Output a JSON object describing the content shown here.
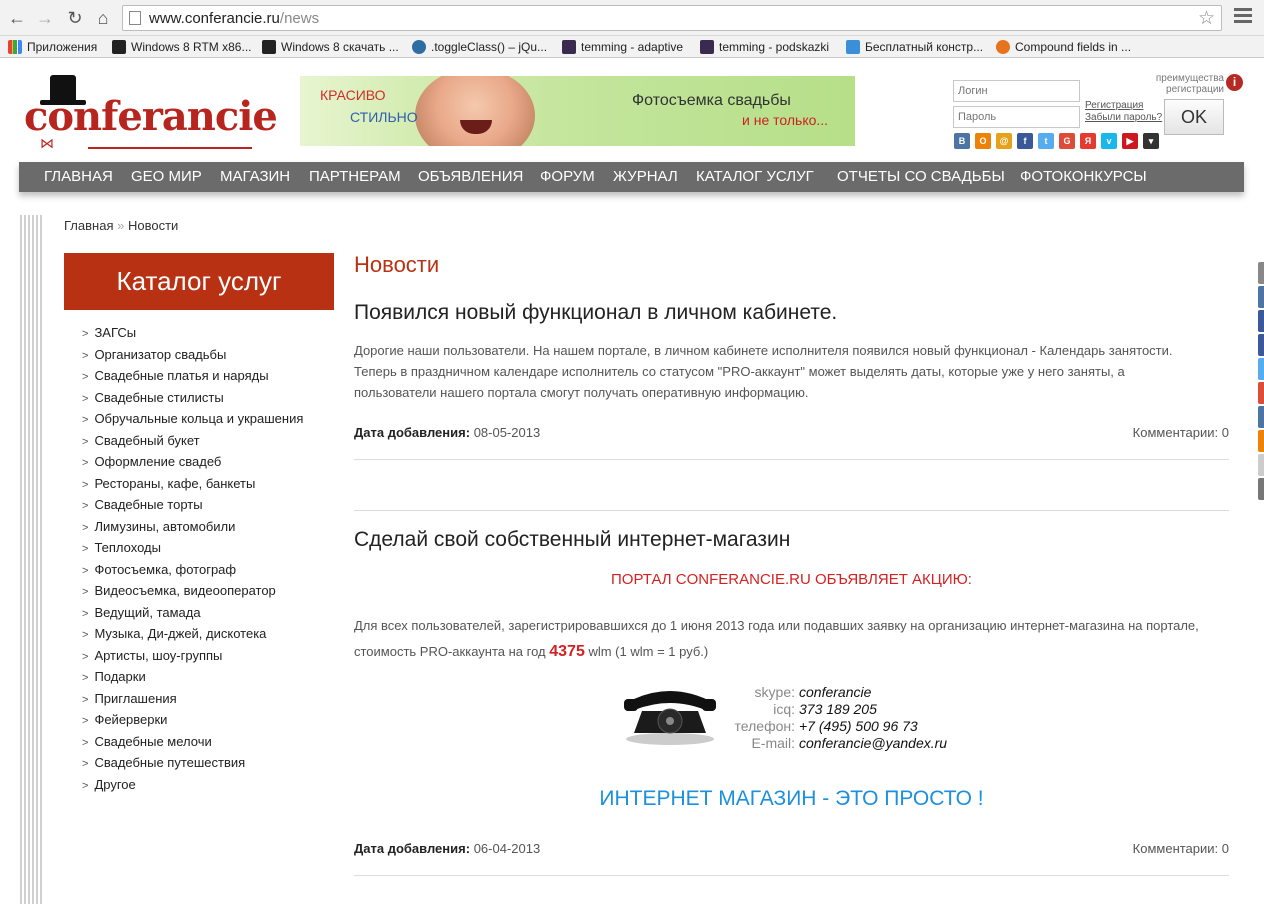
{
  "browser": {
    "url_host": "www.conferancie.ru",
    "url_path": "/news",
    "bookmarks": [
      {
        "label": "Приложения",
        "color": "#e94235"
      },
      {
        "label": "Windows 8 RTM x86...",
        "color": "#222222"
      },
      {
        "label": "Windows 8 скачать ...",
        "color": "#222222"
      },
      {
        "label": ".toggleClass() – jQu...",
        "color": "#2e6da4"
      },
      {
        "label": "temming - adaptive",
        "color": "#3b2a4f"
      },
      {
        "label": "temming - podskazki",
        "color": "#3b2a4f"
      },
      {
        "label": "Бесплатный констр...",
        "color": "#3b8fd8"
      },
      {
        "label": "Compound fields in ...",
        "color": "#e8731f"
      }
    ]
  },
  "header": {
    "logo_text": "conferancie",
    "banner": {
      "line1": "КРАСИВО",
      "line2": "СТИЛЬНО",
      "line3": "Фотосъемка свадьбы",
      "line4": "и не только..."
    },
    "login": {
      "login_placeholder": "Логин",
      "password_placeholder": "Пароль",
      "register_link": "Регистрация",
      "forgot_link": "Забыли пароль?",
      "ok_label": "OK",
      "advantages": "преимущества регистрации"
    },
    "socials": [
      {
        "name": "vkontakte",
        "glyph": "B",
        "color": "#4c75a3"
      },
      {
        "name": "odnoklassniki",
        "glyph": "O",
        "color": "#ee8208"
      },
      {
        "name": "mailru",
        "glyph": "@",
        "color": "#e6a21a"
      },
      {
        "name": "facebook",
        "glyph": "f",
        "color": "#3b5998"
      },
      {
        "name": "twitter",
        "glyph": "t",
        "color": "#55acee"
      },
      {
        "name": "google",
        "glyph": "G",
        "color": "#dd4b39"
      },
      {
        "name": "yandex",
        "glyph": "Я",
        "color": "#e43a2f"
      },
      {
        "name": "vimeo",
        "glyph": "v",
        "color": "#1ab7ea"
      },
      {
        "name": "youtube",
        "glyph": "▶",
        "color": "#cc181e"
      },
      {
        "name": "more",
        "glyph": "▾",
        "color": "#333333"
      }
    ]
  },
  "menu": [
    "ГЛАВНАЯ",
    "GEO МИР",
    "МАГАЗИН",
    "ПАРТНЕРАМ",
    "ОБЪЯВЛЕНИЯ",
    "ФОРУМ",
    "ЖУРНАЛ",
    "КАТАЛОГ УСЛУГ",
    "ОТЧЕТЫ СО СВАДЬБЫ",
    "ФОТОКОНКУРСЫ"
  ],
  "breadcrumb": {
    "home": "Главная",
    "separator": "»",
    "current": "Новости"
  },
  "catalog": {
    "title": "Каталог услуг",
    "items": [
      "ЗАГСы",
      "Организатор свадьбы",
      "Свадебные платья и наряды",
      "Свадебные стилисты",
      "Обручальные кольца и украшения",
      "Свадебный букет",
      "Оформление свадеб",
      "Рестораны, кафе, банкеты",
      "Свадебные торты",
      "Лимузины, автомобили",
      "Теплоходы",
      "Фотосъемка, фотограф",
      "Видеосъемка, видеооператор",
      "Ведущий, тамада",
      "Музыка, Ди-джей, дискотека",
      "Артисты, шоу-группы",
      "Подарки",
      "Приглашения",
      "Фейерверки",
      "Свадебные мелочи",
      "Свадебные путешествия",
      "Другое"
    ]
  },
  "content": {
    "section_title": "Новости",
    "date_label": "Дата добавления:",
    "news": [
      {
        "title": "Появился новый функционал в личном кабинете.",
        "text": "Дорогие наши пользователи. На нашем портале,  в личном кабинете исполнителя появился новый функционал - Календарь занятости. Теперь в праздничном календаре исполнитель со статусом \"PRO-аккаунт\" может выделять даты, которые уже у него заняты, а пользователи нашего портала смогут получать оперативную информацию.",
        "date": "08-05-2013",
        "comments": "Комментарии: 0"
      },
      {
        "title": "Сделай свой собственный интернет-магазин",
        "announce": "ПОРТАЛ CONFERANCIE.RU ОБЪЯВЛЯЕТ АКЦИЮ:",
        "text_before": "Для всех пользователей, зарегистрировавшихся до 1 июня 2013 года или подавших заявку на организацию интернет-магазина на портале, стоимость PRO-аккаунта на год",
        "price": "4375",
        "text_after": "wlm (1 wlm = 1 руб.)",
        "contacts": [
          {
            "key": "skype:",
            "value": "conferancie"
          },
          {
            "key": "icq:",
            "value": "373 189 205"
          },
          {
            "key": "телефон:",
            "value": "+7 (495) 500 96 73"
          },
          {
            "key": "E-mail:",
            "value": "conferancie@yandex.ru"
          }
        ],
        "slogan": "ИНТЕРНЕТ МАГАЗИН - ЭТО ПРОСТО !",
        "date": "06-04-2013",
        "comments": "Комментарии: 0"
      }
    ]
  },
  "share_colors": [
    "#888888",
    "#4c75a3",
    "#3b5998",
    "#3b5998",
    "#55acee",
    "#dd4b39",
    "#4c75a3",
    "#ee8208",
    "#cccccc",
    "#777777"
  ]
}
